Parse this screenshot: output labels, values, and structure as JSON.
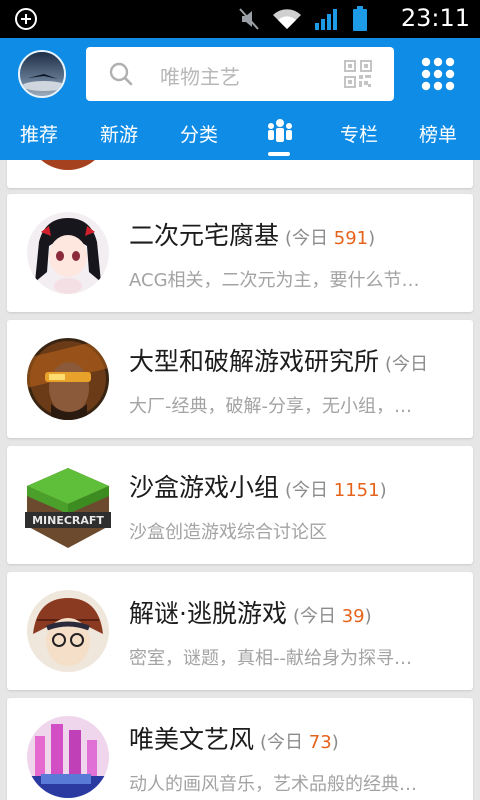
{
  "status_bar": {
    "time": "23:11"
  },
  "header": {
    "search_placeholder": "唯物主艺",
    "tabs": [
      {
        "label": "推荐"
      },
      {
        "label": "新游"
      },
      {
        "label": "分类"
      },
      {
        "label": "专栏"
      },
      {
        "label": "榜单"
      }
    ],
    "active_tab": "groups"
  },
  "groups": [
    {
      "title": "二次元宅腐基",
      "today_label": "今日",
      "count": "591",
      "desc": "ACG相关，二次元为主，要什么节…"
    },
    {
      "title": "大型和破解游戏研究所",
      "today_label": "今日",
      "count": "",
      "desc": "大厂-经典，破解-分享，无小组，…"
    },
    {
      "title": "沙盒游戏小组",
      "today_label": "今日",
      "count": "1151",
      "desc": "沙盒创造游戏综合讨论区"
    },
    {
      "title": "解谜·逃脱游戏",
      "today_label": "今日",
      "count": "39",
      "desc": "密室，谜题，真相--献给身为探寻…"
    },
    {
      "title": "唯美文艺风",
      "today_label": "今日",
      "count": "73",
      "desc": "动人的画风音乐，艺术品般的经典…"
    }
  ],
  "colors": {
    "header": "#0f8ce6",
    "count": "#e6631b"
  }
}
